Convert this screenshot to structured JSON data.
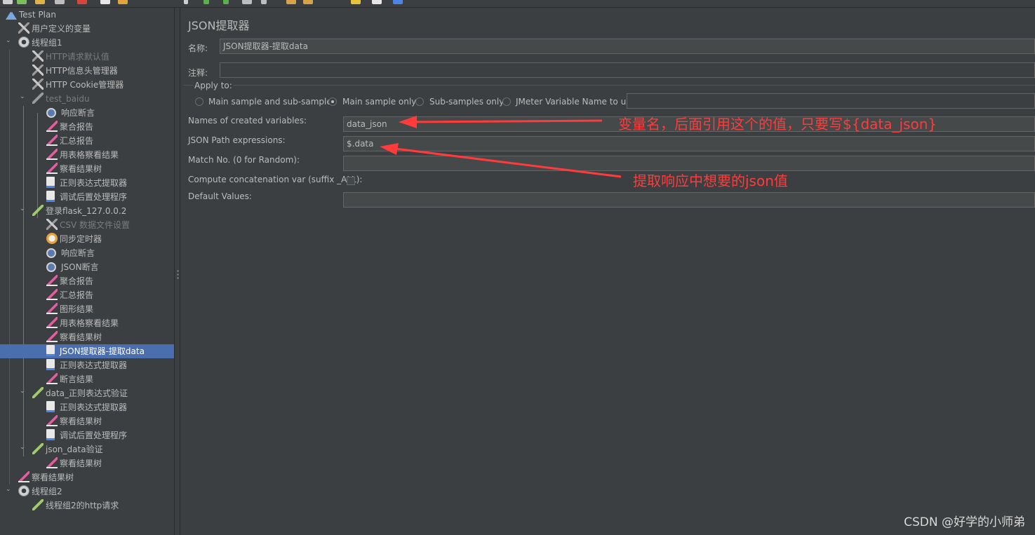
{
  "tree": {
    "nodes": [
      {
        "label": "Test Plan",
        "icon": "flask-icon",
        "disabled": false
      },
      {
        "label": "用户定义的变量",
        "icon": "wrench-icon",
        "disabled": false
      },
      {
        "label": "线程组1",
        "icon": "gear-icon",
        "disabled": false
      },
      {
        "label": "HTTP请求默认值",
        "icon": "wrench-icon",
        "disabled": true
      },
      {
        "label": "HTTP信息头管理器",
        "icon": "wrench-icon",
        "disabled": false
      },
      {
        "label": "HTTP Cookie管理器",
        "icon": "wrench-icon",
        "disabled": false
      },
      {
        "label": "test_baidu",
        "icon": "pen-icon",
        "disabled": true
      },
      {
        "label": "响应断言",
        "icon": "magnifier-icon",
        "disabled": false
      },
      {
        "label": "聚合报告",
        "icon": "chart-icon",
        "disabled": false
      },
      {
        "label": "汇总报告",
        "icon": "chart-icon",
        "disabled": false
      },
      {
        "label": "用表格察看结果",
        "icon": "chart-icon",
        "disabled": false
      },
      {
        "label": "察看结果树",
        "icon": "chart-icon",
        "disabled": false
      },
      {
        "label": "正则表达式提取器",
        "icon": "doc-icon",
        "disabled": false
      },
      {
        "label": "调试后置处理程序",
        "icon": "doc-icon",
        "disabled": false
      },
      {
        "label": "登录flask_127.0.0.2",
        "icon": "pen-icon",
        "disabled": false
      },
      {
        "label": "CSV 数据文件设置",
        "icon": "wrench-icon",
        "disabled": true
      },
      {
        "label": "同步定时器",
        "icon": "timer-icon",
        "disabled": false
      },
      {
        "label": "响应断言",
        "icon": "magnifier-icon",
        "disabled": false
      },
      {
        "label": "JSON断言",
        "icon": "magnifier-icon",
        "disabled": false
      },
      {
        "label": "聚合报告",
        "icon": "chart-icon",
        "disabled": false
      },
      {
        "label": "汇总报告",
        "icon": "chart-icon",
        "disabled": false
      },
      {
        "label": "图形结果",
        "icon": "chart-icon",
        "disabled": false
      },
      {
        "label": "用表格察看结果",
        "icon": "chart-icon",
        "disabled": false
      },
      {
        "label": "察看结果树",
        "icon": "chart-icon",
        "disabled": false
      },
      {
        "label": "JSON提取器-提取data",
        "icon": "doc-icon",
        "disabled": false
      },
      {
        "label": "正则表达式提取器",
        "icon": "doc-icon",
        "disabled": false
      },
      {
        "label": "断言结果",
        "icon": "chart-icon",
        "disabled": false
      },
      {
        "label": "data_正则表达式验证",
        "icon": "pen-icon",
        "disabled": false
      },
      {
        "label": "正则表达式提取器",
        "icon": "doc-icon",
        "disabled": false
      },
      {
        "label": "察看结果树",
        "icon": "chart-icon",
        "disabled": false
      },
      {
        "label": "调试后置处理程序",
        "icon": "doc-icon",
        "disabled": false
      },
      {
        "label": "json_data验证",
        "icon": "pen-icon",
        "disabled": false
      },
      {
        "label": "察看结果树",
        "icon": "chart-icon",
        "disabled": false
      },
      {
        "label": "察看结果树",
        "icon": "chart-icon",
        "disabled": false
      },
      {
        "label": "线程组2",
        "icon": "gear-icon",
        "disabled": false
      },
      {
        "label": "线程组2的http请求",
        "icon": "pen-icon",
        "disabled": false
      }
    ]
  },
  "panel": {
    "title": "JSON提取器",
    "name_label": "名称:",
    "name_value": "JSON提取器-提取data",
    "comment_label": "注释:",
    "comment_value": "",
    "apply_to": {
      "legend": "Apply to:",
      "options": [
        "Main sample and sub-samples",
        "Main sample only",
        "Sub-samples only",
        "JMeter Variable Name to use"
      ],
      "selected": "Main sample only",
      "variable_value": ""
    },
    "fields": [
      {
        "label": "Names of created variables:",
        "value": "data_json"
      },
      {
        "label": "JSON Path expressions:",
        "value": "$.data"
      },
      {
        "label": "Match No. (0 for Random):",
        "value": ""
      },
      {
        "label": "Compute concatenation var (suffix _ALL):",
        "value": ""
      },
      {
        "label": "Default Values:",
        "value": ""
      }
    ]
  },
  "annotations": {
    "variable_note": "变量名，后面引用这个的值，只要写${data_json}",
    "json_note": "提取响应中想要的json值",
    "color": "#ff3b3b"
  },
  "watermark": "CSDN @好学的小师弟",
  "colors": {
    "background": "#3c3f41",
    "selection": "#4b6eaf",
    "field": "#45494a"
  }
}
